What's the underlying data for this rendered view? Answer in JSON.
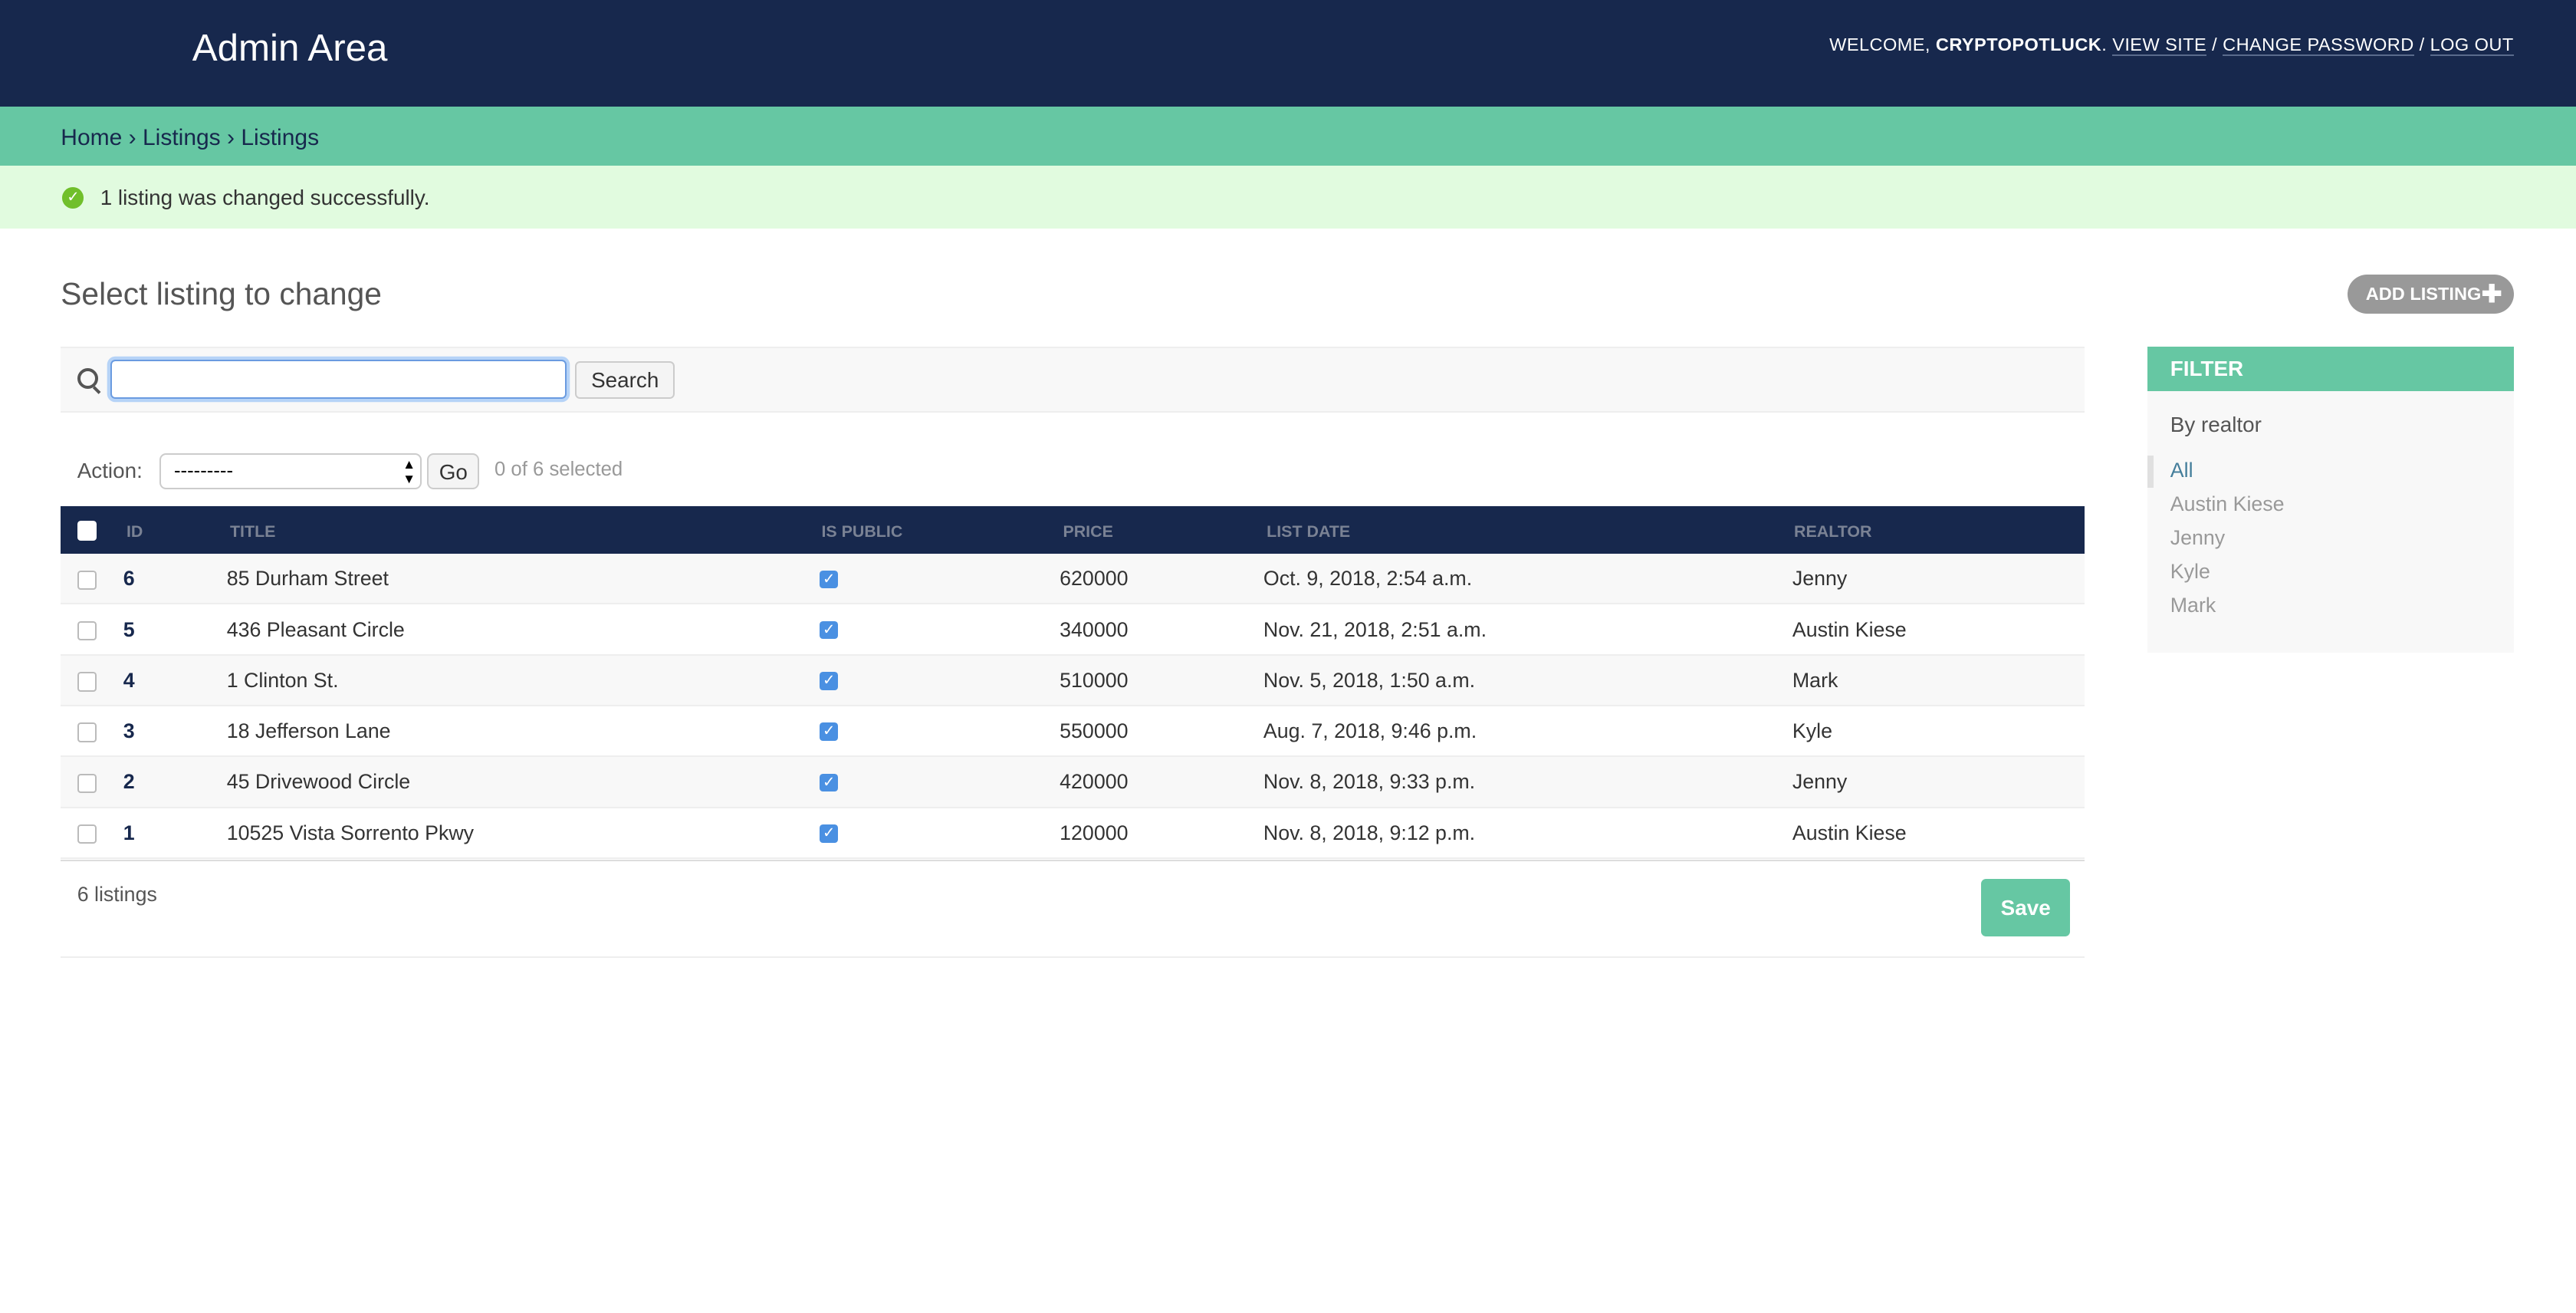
{
  "header": {
    "title": "Admin Area",
    "welcome": "WELCOME,",
    "username": "CRYPTOPOTLUCK",
    "view_site": "VIEW SITE",
    "change_password": "CHANGE PASSWORD",
    "log_out": "LOG OUT",
    "separator": "/"
  },
  "breadcrumb": "Home › Listings › Listings",
  "message": "1 listing was changed successfully.",
  "page_title": "Select listing to change",
  "add_button": "ADD LISTING",
  "search": {
    "value": "",
    "button": "Search"
  },
  "actions": {
    "label": "Action:",
    "selected": "---------",
    "go": "Go",
    "selection": "0 of 6 selected"
  },
  "table": {
    "columns": [
      "ID",
      "TITLE",
      "IS PUBLIC",
      "PRICE",
      "LIST DATE",
      "REALTOR"
    ],
    "rows": [
      {
        "id": "6",
        "title": "85 Durham Street",
        "is_public": true,
        "price": "620000",
        "list_date": "Oct. 9, 2018, 2:54 a.m.",
        "realtor": "Jenny"
      },
      {
        "id": "5",
        "title": "436 Pleasant Circle",
        "is_public": true,
        "price": "340000",
        "list_date": "Nov. 21, 2018, 2:51 a.m.",
        "realtor": "Austin Kiese"
      },
      {
        "id": "4",
        "title": "1 Clinton St.",
        "is_public": true,
        "price": "510000",
        "list_date": "Nov. 5, 2018, 1:50 a.m.",
        "realtor": "Mark"
      },
      {
        "id": "3",
        "title": "18 Jefferson Lane",
        "is_public": true,
        "price": "550000",
        "list_date": "Aug. 7, 2018, 9:46 p.m.",
        "realtor": "Kyle"
      },
      {
        "id": "2",
        "title": "45 Drivewood Circle",
        "is_public": true,
        "price": "420000",
        "list_date": "Nov. 8, 2018, 9:33 p.m.",
        "realtor": "Jenny"
      },
      {
        "id": "1",
        "title": "10525 Vista Sorrento Pkwy",
        "is_public": true,
        "price": "120000",
        "list_date": "Nov. 8, 2018, 9:12 p.m.",
        "realtor": "Austin Kiese"
      }
    ]
  },
  "footer": {
    "count": "6 listings",
    "save": "Save"
  },
  "filter": {
    "title": "FILTER",
    "subtitle": "By realtor",
    "items": [
      "All",
      "Austin Kiese",
      "Jenny",
      "Kyle",
      "Mark"
    ],
    "selected": "All"
  },
  "colors": {
    "header": "#17284d",
    "accent": "#66c7a3",
    "message_bg": "#e1fbdf"
  }
}
